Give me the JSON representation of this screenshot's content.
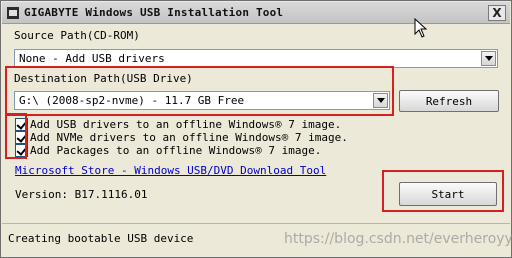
{
  "window": {
    "title": "GIGABYTE Windows USB Installation Tool",
    "close_glyph": "X"
  },
  "source": {
    "label": "Source Path(CD-ROM)",
    "value": "None - Add USB drivers"
  },
  "destination": {
    "label": "Destination Path(USB Drive)",
    "value": "G:\\ (2008-sp2-nvme) - 11.7 GB Free",
    "refresh_label": "Refresh"
  },
  "options": [
    {
      "label": "Add USB drivers to an offline Windows® 7 image.",
      "checked": true
    },
    {
      "label": "Add NVMe drivers to an offline Windows® 7 image.",
      "checked": true
    },
    {
      "label": "Add Packages  to an offline Windows® 7 image.",
      "checked": true
    }
  ],
  "link": {
    "text": "Microsoft Store - Windows USB/DVD Download Tool"
  },
  "version": {
    "text": "Version: B17.1116.01"
  },
  "start_label": "Start",
  "status": {
    "text": "Creating bootable USB device"
  },
  "watermark": "https://blog.csdn.net/everheroyy",
  "colors": {
    "highlight": "#d42020",
    "link": "#0000cc"
  }
}
